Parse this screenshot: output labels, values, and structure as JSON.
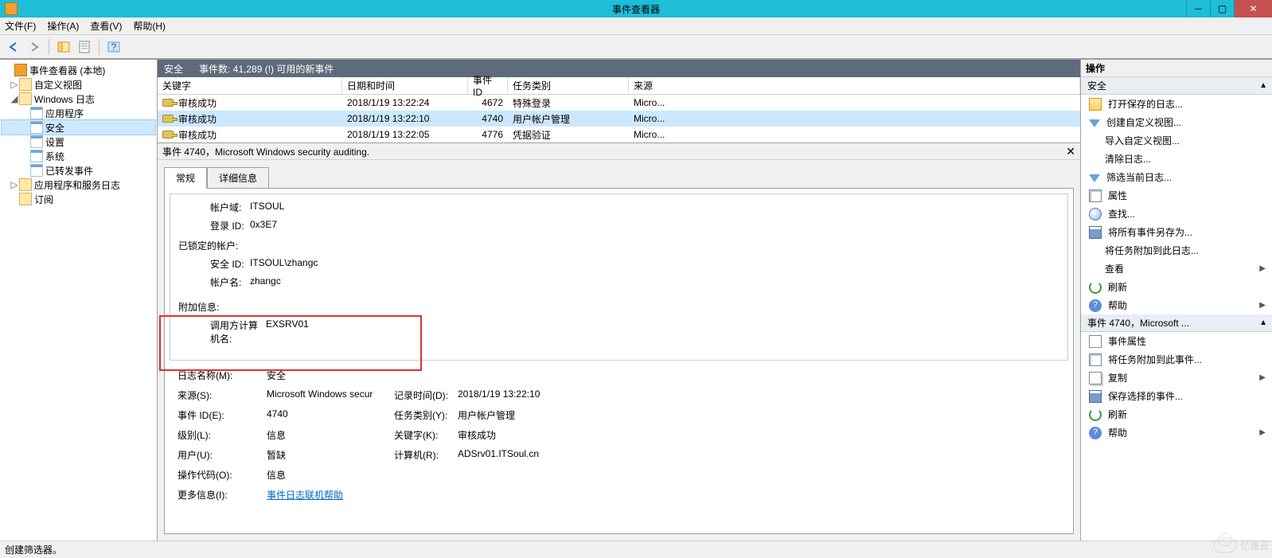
{
  "window": {
    "title": "事件查看器"
  },
  "menu": {
    "file": "文件(F)",
    "action": "操作(A)",
    "view": "查看(V)",
    "help": "帮助(H)"
  },
  "tree": {
    "root": "事件查看器 (本地)",
    "custom_views": "自定义视图",
    "windows_logs": "Windows 日志",
    "application": "应用程序",
    "security": "安全",
    "setup": "设置",
    "system": "系统",
    "forwarded": "已转发事件",
    "apps_services": "应用程序和服务日志",
    "subscriptions": "订阅"
  },
  "center": {
    "title": "安全",
    "count_label": "事件数: 41,289 (!) 可用的新事件",
    "cols": {
      "keyword": "关键字",
      "datetime": "日期和时间",
      "event_id": "事件 ID",
      "task": "任务类别",
      "source": "来源"
    },
    "rows": [
      {
        "keyword": "审核成功",
        "datetime": "2018/1/19 13:22:24",
        "id": "4672",
        "task": "特殊登录",
        "source": "Micro..."
      },
      {
        "keyword": "审核成功",
        "datetime": "2018/1/19 13:22:10",
        "id": "4740",
        "task": "用户帐户管理",
        "source": "Micro..."
      },
      {
        "keyword": "审核成功",
        "datetime": "2018/1/19 13:22:05",
        "id": "4776",
        "task": "凭据验证",
        "source": "Micro..."
      }
    ]
  },
  "detail": {
    "title": "事件 4740，Microsoft Windows security auditing.",
    "tabs": {
      "general": "常规",
      "details": "详细信息"
    },
    "body": {
      "account_domain_label": "帐户域:",
      "account_domain": "ITSOUL",
      "logon_id_label": "登录 ID:",
      "logon_id": "0x3E7",
      "locked_account_label": "已锁定的帐户:",
      "security_id_label": "安全 ID:",
      "security_id": "ITSOUL\\zhangc",
      "account_name_label": "帐户名:",
      "account_name": "zhangc",
      "extra_label": "附加信息:",
      "caller_label": "调用方计算机名:",
      "caller": "EXSRV01"
    },
    "meta": {
      "log_name_label": "日志名称(M):",
      "log_name": "安全",
      "source_label": "来源(S):",
      "source": "Microsoft Windows secur",
      "logged_label": "记录时间(D):",
      "logged": "2018/1/19 13:22:10",
      "event_id_label": "事件 ID(E):",
      "event_id": "4740",
      "task_label": "任务类别(Y):",
      "task": "用户帐户管理",
      "level_label": "级别(L):",
      "level": "信息",
      "keywords_label": "关键字(K):",
      "keywords": "审核成功",
      "user_label": "用户(U):",
      "user": "暂缺",
      "computer_label": "计算机(R):",
      "computer": "ADSrv01.ITSoul.cn",
      "opcode_label": "操作代码(O):",
      "opcode": "信息",
      "more_label": "更多信息(I):",
      "more_link": "事件日志联机帮助"
    }
  },
  "actions": {
    "title": "操作",
    "hdr1": "安全",
    "open_saved": "打开保存的日志...",
    "create_view": "创建自定义视图...",
    "import_view": "导入自定义视图...",
    "clear_log": "清除日志...",
    "filter_log": "筛选当前日志...",
    "properties": "属性",
    "find": "查找...",
    "save_all": "将所有事件另存为...",
    "attach_task_log": "将任务附加到此日志...",
    "view": "查看",
    "refresh": "刷新",
    "help": "帮助",
    "hdr2": "事件 4740，Microsoft ...",
    "event_props": "事件属性",
    "attach_task_event": "将任务附加到此事件...",
    "copy": "复制",
    "save_selected": "保存选择的事件...",
    "refresh2": "刷新",
    "help2": "帮助"
  },
  "status": "创建筛选器。",
  "watermark": "亿速云"
}
